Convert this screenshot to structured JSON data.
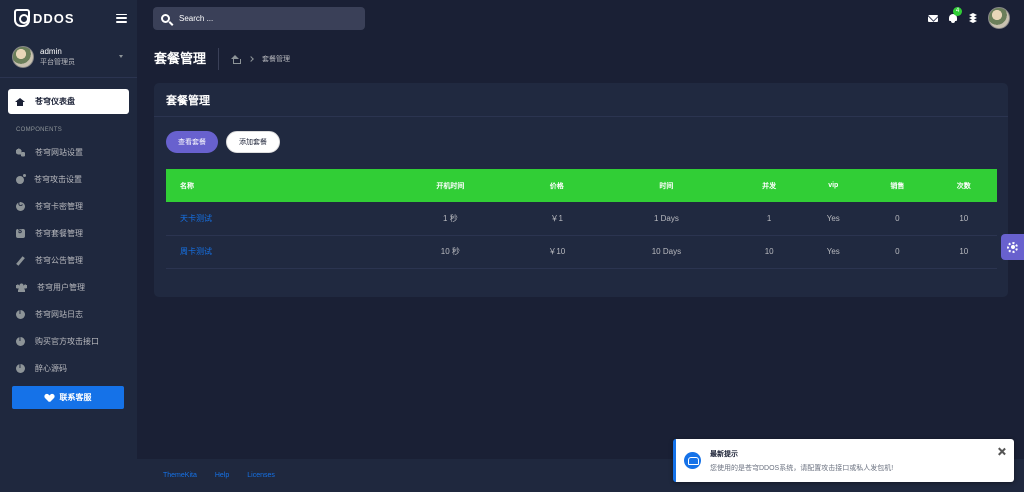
{
  "brand": {
    "name": "DDOS"
  },
  "topbar": {
    "search_placeholder": "Search ...",
    "notification_count": "4"
  },
  "user": {
    "name": "admin",
    "role": "平台管理员"
  },
  "sidebar": {
    "dashboard_label": "苍穹仪表盘",
    "section_title": "COMPONENTS",
    "items": [
      {
        "icon": "gears-icon",
        "label": "苍穹网站设置"
      },
      {
        "icon": "bomb-icon",
        "label": "苍穹攻击设置"
      },
      {
        "icon": "copyright-icon",
        "label": "苍穹卡密管理"
      },
      {
        "icon": "money-icon",
        "label": "苍穹套餐管理"
      },
      {
        "icon": "pen-icon",
        "label": "苍穹公告管理"
      },
      {
        "icon": "users-icon",
        "label": "苍穹用户管理"
      },
      {
        "icon": "info-icon",
        "label": "苍穹网站日志"
      },
      {
        "icon": "info-icon",
        "label": "购买官方攻击接口"
      },
      {
        "icon": "info-icon",
        "label": "醉心源码"
      }
    ],
    "contact_label": "联系客服"
  },
  "page": {
    "title": "套餐管理",
    "breadcrumb_current": "套餐管理"
  },
  "card": {
    "title": "套餐管理",
    "view_button": "查看套餐",
    "add_button": "添加套餐",
    "columns": [
      "名称",
      "开机时间",
      "价格",
      "时间",
      "并发",
      "vip",
      "销售",
      "次数"
    ],
    "rows": [
      [
        "天卡测试",
        "1 秒",
        "￥1",
        "1 Days",
        "1",
        "Yes",
        "0",
        "10"
      ],
      [
        "周卡测试",
        "10 秒",
        "￥10",
        "10 Days",
        "10",
        "Yes",
        "0",
        "10"
      ]
    ]
  },
  "footer": {
    "links": [
      "ThemeKita",
      "Help",
      "Licenses"
    ]
  },
  "notification": {
    "title": "最新提示",
    "message": "您使用的是苍穹DDOS系统，请配置攻击接口或私人发包机!"
  },
  "colors": {
    "primary": "#1572e8",
    "secondary": "#6861ce",
    "success": "#31ce36",
    "bg": "#1a2035"
  }
}
